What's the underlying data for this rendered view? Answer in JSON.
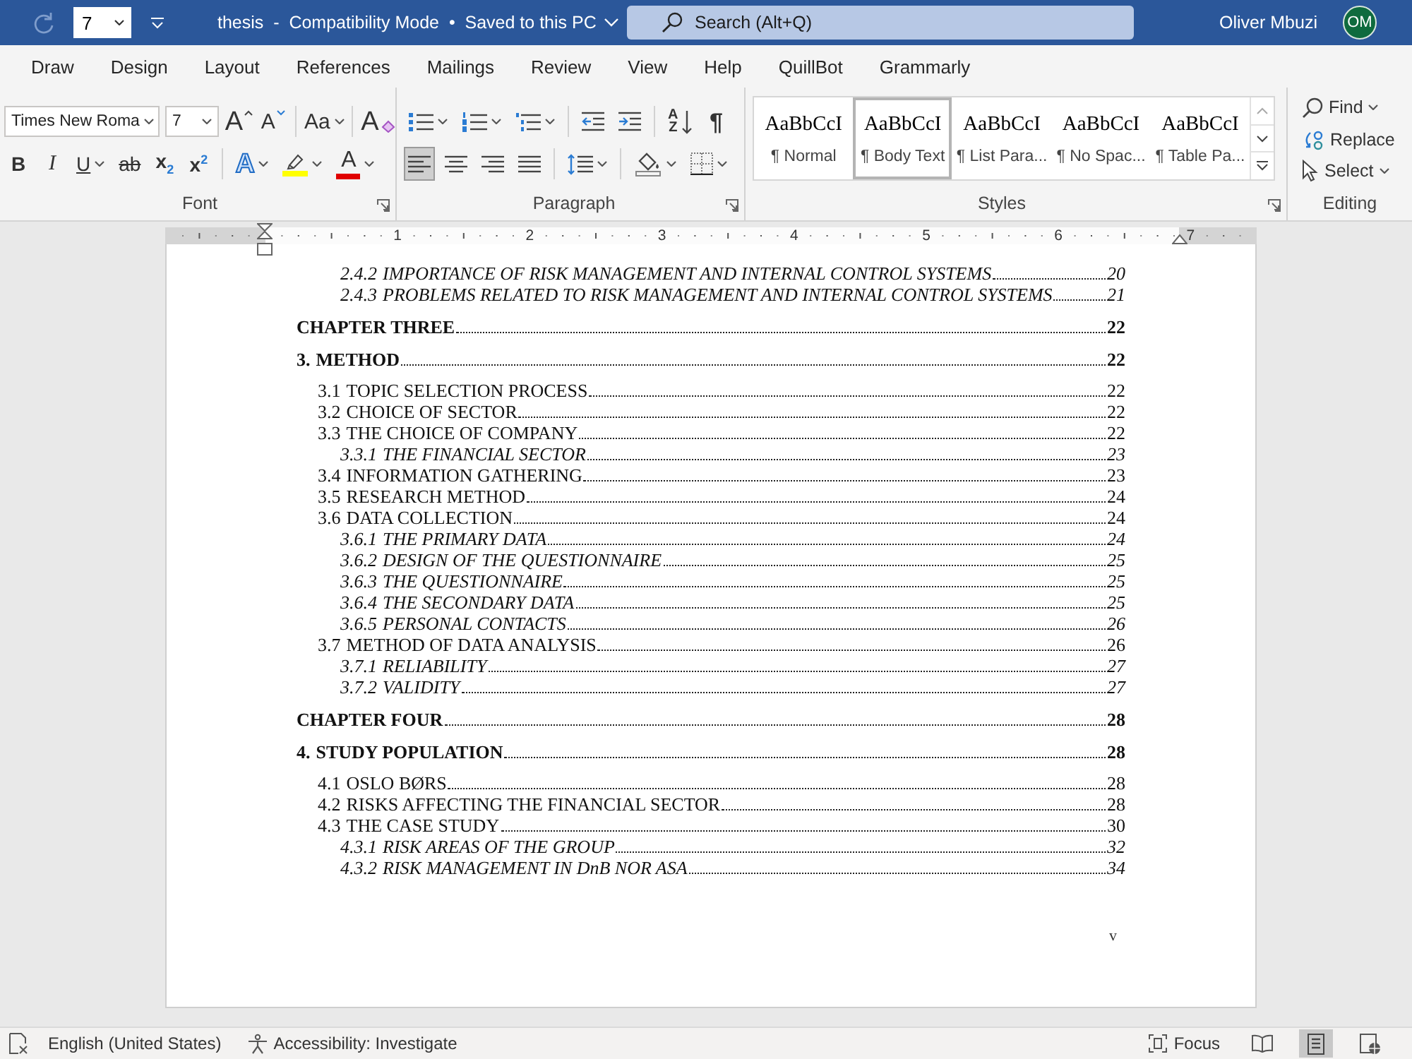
{
  "title_bar": {
    "quick_font_size": "7",
    "title": "thesis  -  Compatibility Mode  •  Saved to this PC",
    "search": {
      "placeholder": "Search (Alt+Q)"
    },
    "user": {
      "name": "Oliver Mbuzi",
      "initials": "OM"
    }
  },
  "ribbon_tabs": [
    {
      "label": "Draw",
      "selected": false
    },
    {
      "label": "Design",
      "selected": false
    },
    {
      "label": "Layout",
      "selected": false
    },
    {
      "label": "References",
      "selected": false
    },
    {
      "label": "Mailings",
      "selected": false
    },
    {
      "label": "Review",
      "selected": false
    },
    {
      "label": "View",
      "selected": false
    },
    {
      "label": "Help",
      "selected": false
    },
    {
      "label": "QuillBot",
      "selected": false
    },
    {
      "label": "Grammarly",
      "selected": false
    }
  ],
  "ribbon": {
    "font": {
      "label": "Font",
      "font_name": "Times New Roma",
      "font_size": "7",
      "row_1": [
        {
          "kind": "grow",
          "glyph": "A"
        },
        {
          "kind": "shrink",
          "glyph": "A"
        },
        {
          "kind": "separator"
        },
        {
          "kind": "change-case",
          "glyph": "Aa",
          "dropdown": true
        },
        {
          "kind": "separator"
        },
        {
          "kind": "clear",
          "glyph": "A"
        }
      ],
      "row_2": [
        {
          "kind": "bold",
          "glyph": "B"
        },
        {
          "kind": "italic",
          "glyph": "I"
        },
        {
          "kind": "underline",
          "glyph": "U",
          "dropdown": true
        },
        {
          "kind": "strikethrough",
          "glyph": "ab"
        },
        {
          "kind": "subscript",
          "glyph": "x$_{2}$"
        },
        {
          "kind": "superscript",
          "glyph": "x$^{2}$"
        },
        {
          "kind": "separator"
        },
        {
          "kind": "text-effects",
          "glyph": "A",
          "dropdown": true
        },
        {
          "kind": "highlight",
          "dropdown": true
        },
        {
          "kind": "font-color",
          "glyph": "A",
          "dropdown": true
        }
      ]
    },
    "paragraph": {
      "label": "Paragraph",
      "row_1": [
        {
          "kind": "bullets",
          "dropdown": true
        },
        {
          "kind": "numbering",
          "dropdown": true
        },
        {
          "kind": "multilevel",
          "dropdown": true
        },
        {
          "kind": "separator"
        },
        {
          "kind": "decrease-indent"
        },
        {
          "kind": "increase-indent"
        },
        {
          "kind": "separator"
        },
        {
          "kind": "sort",
          "glyph": "A",
          "glyph_2": "Z"
        },
        {
          "kind": "show-marks",
          "glyph": "¶"
        }
      ],
      "alignment": [
        {
          "kind": "align-left",
          "selected": true
        },
        {
          "kind": "align-center",
          "selected": false
        },
        {
          "kind": "align-right",
          "selected": false
        },
        {
          "kind": "justify",
          "selected": false
        }
      ],
      "row_2": [
        {
          "kind": "separator"
        },
        {
          "kind": "line-spacing",
          "dropdown": true
        },
        {
          "kind": "separator"
        },
        {
          "kind": "shading",
          "dropdown": true
        },
        {
          "kind": "borders",
          "dropdown": true
        }
      ]
    },
    "styles": {
      "label": "Styles",
      "items": [
        {
          "preview": "AaBbCcI",
          "name": "¶ Normal",
          "selected": false
        },
        {
          "preview": "AaBbCcI",
          "name": "¶ Body Text",
          "selected": true
        },
        {
          "preview": "AaBbCcI",
          "name": "¶ List Para...",
          "selected": false
        },
        {
          "preview": "AaBbCcI",
          "name": "¶ No Spac...",
          "selected": false
        },
        {
          "preview": "AaBbCcI",
          "name": "¶ Table Pa...",
          "selected": false
        }
      ]
    },
    "editing": {
      "label": "Editing",
      "items": [
        {
          "kind": "find",
          "label": "Find",
          "dropdown": true
        },
        {
          "kind": "replace",
          "label": "Replace"
        },
        {
          "kind": "select",
          "label": "Select",
          "dropdown": true
        }
      ]
    }
  },
  "ruler": {
    "numbers": [
      "1",
      "2",
      "3",
      "4",
      "5",
      "6",
      "7"
    ]
  },
  "document": {
    "continued_entries": [
      {
        "number": "2.4.2",
        "title": "IMPORTANCE OF RISK MANAGEMENT AND INTERNAL CONTROL SYSTEMS",
        "page": "20"
      },
      {
        "number": "2.4.3",
        "title": "PROBLEMS RELATED TO RISK MANAGEMENT AND INTERNAL CONTROL SYSTEMS",
        "page": "21"
      }
    ],
    "toc": [
      {
        "title": "CHAPTER THREE",
        "page": "22"
      },
      {
        "number": "3.",
        "title": "METHOD",
        "page": "22",
        "children": [
          {
            "number": "3.1",
            "title": "TOPIC SELECTION PROCESS",
            "page": "22"
          },
          {
            "number": "3.2",
            "title": "CHOICE OF SECTOR",
            "page": "22"
          },
          {
            "number": "3.3",
            "title": "THE CHOICE OF COMPANY",
            "page": "22",
            "children": [
              {
                "number": "3.3.1",
                "title": "THE FINANCIAL SECTOR",
                "page": "23"
              }
            ]
          },
          {
            "number": "3.4",
            "title": "INFORMATION GATHERING",
            "page": "23"
          },
          {
            "number": "3.5",
            "title": "RESEARCH METHOD",
            "page": "24"
          },
          {
            "number": "3.6",
            "title": "DATA COLLECTION",
            "page": "24",
            "children": [
              {
                "number": "3.6.1",
                "title": "THE PRIMARY DATA",
                "page": "24"
              },
              {
                "number": "3.6.2",
                "title": "DESIGN OF THE QUESTIONNAIRE",
                "page": "25"
              },
              {
                "number": "3.6.3",
                "title": "THE QUESTIONNAIRE",
                "page": "25"
              },
              {
                "number": "3.6.4",
                "title": "THE SECONDARY DATA",
                "page": "25"
              },
              {
                "number": "3.6.5",
                "title": "PERSONAL CONTACTS",
                "page": "26"
              }
            ]
          },
          {
            "number": "3.7",
            "title": "METHOD OF DATA ANALYSIS",
            "page": "26",
            "children": [
              {
                "number": "3.7.1",
                "title": "RELIABILITY",
                "page": "27"
              },
              {
                "number": "3.7.2",
                "title": "VALIDITY",
                "page": "27"
              }
            ]
          }
        ]
      },
      {
        "title": "CHAPTER FOUR",
        "page": "28"
      },
      {
        "number": "4.",
        "title": "STUDY POPULATION",
        "page": "28",
        "children": [
          {
            "number": "4.1",
            "title": "OSLO BØRS",
            "page": "28"
          },
          {
            "number": "4.2",
            "title": "RISKS AFFECTING THE FINANCIAL SECTOR",
            "page": "28"
          },
          {
            "number": "4.3",
            "title": "THE CASE STUDY",
            "page": "30",
            "children": [
              {
                "number": "4.3.1",
                "title": "RISK AREAS OF THE GROUP",
                "page": "32"
              },
              {
                "number": "4.3.2",
                "title": "RISK MANAGEMENT IN DnB NOR ASA",
                "page": "34"
              }
            ]
          }
        ]
      }
    ],
    "page_number": "v"
  },
  "status_bar": {
    "language": "English (United States)",
    "accessibility": "Accessibility: Investigate",
    "focus": "Focus",
    "views": [
      {
        "kind": "read-mode",
        "selected": false
      },
      {
        "kind": "print-layout",
        "selected": true
      },
      {
        "kind": "web-layout",
        "selected": false
      }
    ]
  }
}
